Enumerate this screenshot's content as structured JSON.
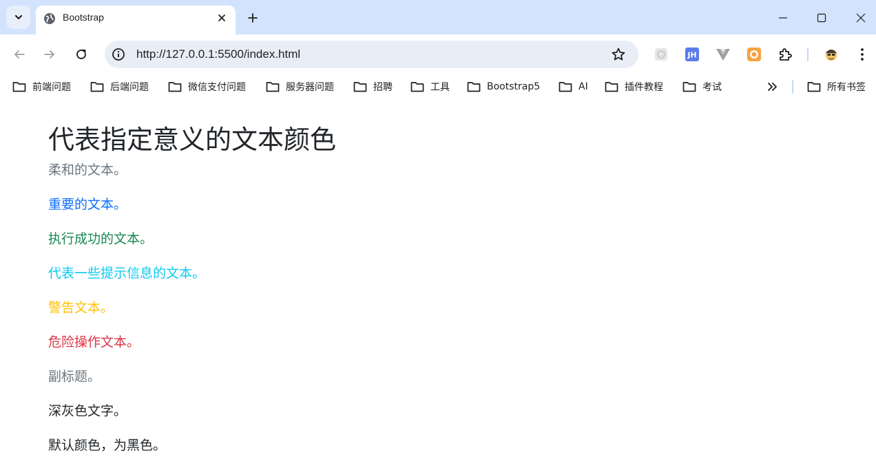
{
  "browser": {
    "tab_title": "Bootstrap",
    "url": "http://127.0.0.1:5500/index.html"
  },
  "bookmarks": [
    {
      "label": "前端问题"
    },
    {
      "label": "后端问题"
    },
    {
      "label": "微信支付问题"
    },
    {
      "label": "服务器问题"
    },
    {
      "label": "招聘"
    },
    {
      "label": "工具"
    },
    {
      "label": "Bootstrap5"
    },
    {
      "label": "AI"
    },
    {
      "label": "插件教程"
    },
    {
      "label": "考试"
    }
  ],
  "all_bookmarks": "所有书签",
  "page": {
    "heading": "代表指定意义的文本颜色",
    "lines": [
      {
        "text": "柔和的文本。",
        "color": "#6c757d"
      },
      {
        "text": "重要的文本。",
        "color": "#0d6efd"
      },
      {
        "text": "执行成功的文本。",
        "color": "#198754"
      },
      {
        "text": "代表一些提示信息的文本。",
        "color": "#0dcaf0"
      },
      {
        "text": "警告文本。",
        "color": "#ffc107"
      },
      {
        "text": "危险操作文本。",
        "color": "#dc3545"
      },
      {
        "text": "副标题。",
        "color": "#6c757d"
      },
      {
        "text": "深灰色文字。",
        "color": "#212529"
      },
      {
        "text": "默认颜色，为黑色。",
        "color": "#212529"
      }
    ]
  },
  "colors": {
    "tabstrip": "#d3e3fd",
    "omnibox": "#e9eef6"
  }
}
